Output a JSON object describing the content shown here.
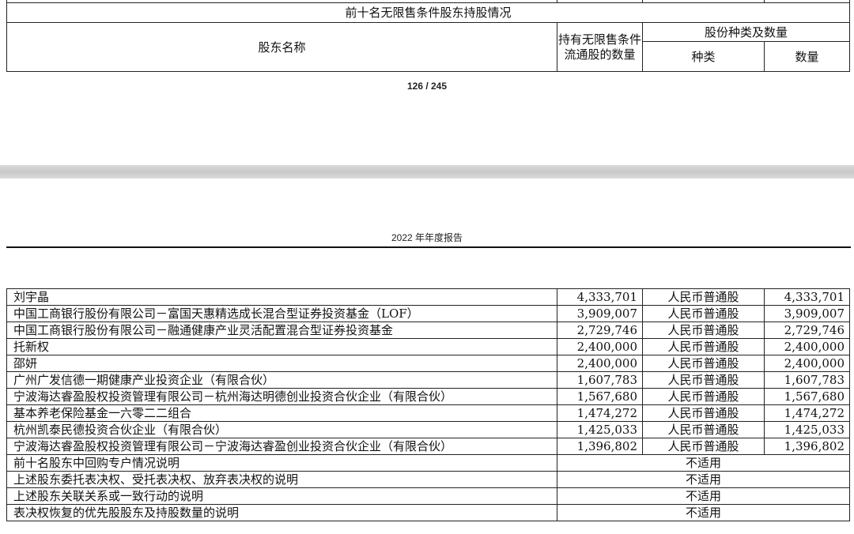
{
  "top_page": {
    "section_title": "前十名无限售条件股东持股情况",
    "col_holder_name": "股东名称",
    "col_unrestricted_qty": "持有无限售条件流通股的数量",
    "col_share_type_qty": "股份种类及数量",
    "col_type": "种类",
    "col_qty": "数量",
    "page_number": "126 / 245"
  },
  "bottom_page": {
    "running_header": "2022 年年度报告",
    "holders": [
      {
        "name": "刘宇晶",
        "qty": "4,333,701",
        "type": "人民币普通股",
        "type_qty": "4,333,701"
      },
      {
        "name": "中国工商银行股份有限公司－富国天惠精选成长混合型证券投资基金（LOF）",
        "qty": "3,909,007",
        "type": "人民币普通股",
        "type_qty": "3,909,007"
      },
      {
        "name": "中国工商银行股份有限公司－融通健康产业灵活配置混合型证券投资基金",
        "qty": "2,729,746",
        "type": "人民币普通股",
        "type_qty": "2,729,746"
      },
      {
        "name": "托新权",
        "qty": "2,400,000",
        "type": "人民币普通股",
        "type_qty": "2,400,000"
      },
      {
        "name": "邵妍",
        "qty": "2,400,000",
        "type": "人民币普通股",
        "type_qty": "2,400,000"
      },
      {
        "name": "广州广发信德一期健康产业投资企业（有限合伙）",
        "qty": "1,607,783",
        "type": "人民币普通股",
        "type_qty": "1,607,783"
      },
      {
        "name": "宁波海达睿盈股权投资管理有限公司－杭州海达明德创业投资合伙企业（有限合伙）",
        "qty": "1,567,680",
        "type": "人民币普通股",
        "type_qty": "1,567,680"
      },
      {
        "name": "基本养老保险基金一六零二二组合",
        "qty": "1,474,272",
        "type": "人民币普通股",
        "type_qty": "1,474,272"
      },
      {
        "name": "杭州凯泰民德投资合伙企业（有限合伙）",
        "qty": "1,425,033",
        "type": "人民币普通股",
        "type_qty": "1,425,033"
      },
      {
        "name": "宁波海达睿盈股权投资管理有限公司－宁波海达睿盈创业投资合伙企业（有限合伙）",
        "qty": "1,396,802",
        "type": "人民币普通股",
        "type_qty": "1,396,802"
      }
    ],
    "notes": [
      {
        "label": "前十名股东中回购专户情况说明",
        "value": "不适用"
      },
      {
        "label": "上述股东委托表决权、受托表决权、放弃表决权的说明",
        "value": "不适用"
      },
      {
        "label": "上述股东关联关系或一致行动的说明",
        "value": "不适用"
      },
      {
        "label": "表决权恢复的优先股股东及持股数量的说明",
        "value": "不适用"
      }
    ]
  }
}
